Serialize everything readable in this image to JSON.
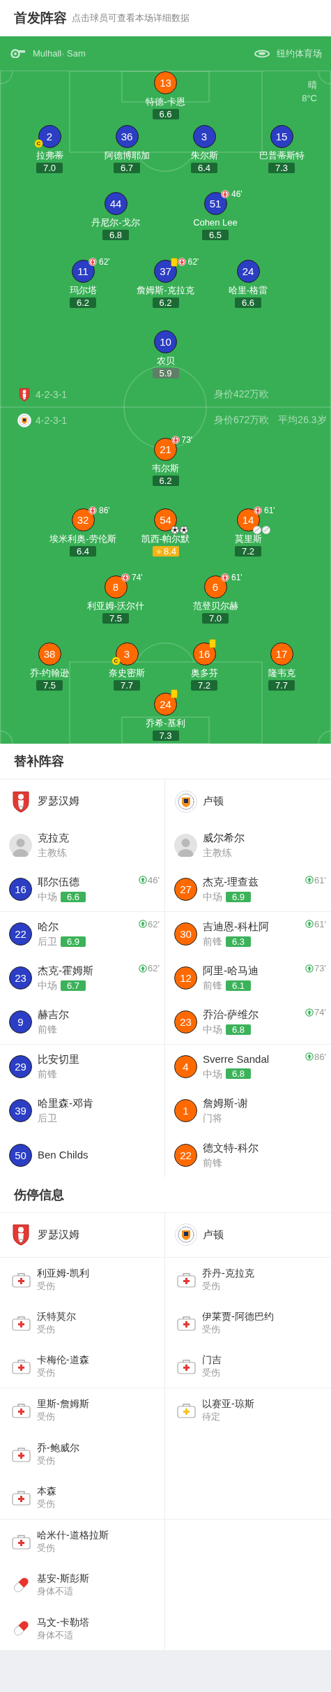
{
  "header": {
    "title": "首发阵容",
    "subtitle": "点击球员可查看本场详细数据"
  },
  "match_info": {
    "referee": "Mulhall· Sam",
    "venue": "纽约体育场",
    "weather": "晴",
    "temperature": "8°C"
  },
  "home": {
    "lines": [
      [
        {
          "number": "13",
          "name": "特德-卡恩",
          "rating": "6.6",
          "low_rating": false,
          "best_player": false,
          "color": "#ff6a00",
          "yellow_card": false
        }
      ],
      [
        {
          "number": "2",
          "name": "拉弗蒂",
          "rating": "7.0",
          "low_rating": false,
          "best_player": false,
          "color": "#2b3ec4",
          "captain_badge": "C",
          "yellow_card": false
        },
        {
          "number": "36",
          "name": "阿德博耶加",
          "rating": "6.7",
          "low_rating": false,
          "best_player": false,
          "color": "#2b3ec4",
          "yellow_card": false
        },
        {
          "number": "3",
          "name": "朱尔斯",
          "rating": "6.4",
          "low_rating": false,
          "best_player": false,
          "color": "#2b3ec4",
          "yellow_card": false
        },
        {
          "number": "15",
          "name": "巴普蒂斯特",
          "rating": "7.3",
          "low_rating": false,
          "best_player": false,
          "color": "#2b3ec4",
          "yellow_card": false
        }
      ],
      [
        {
          "number": "44",
          "name": "丹尼尔-戈尔",
          "rating": "6.8",
          "low_rating": false,
          "best_player": false,
          "color": "#2b3ec4",
          "yellow_card": false
        },
        {
          "number": "51",
          "name": "Cohen Lee",
          "rating": "6.5",
          "low_rating": false,
          "best_player": false,
          "color": "#2b3ec4",
          "yellow_card": false,
          "sub_off": "46'"
        }
      ],
      [
        {
          "number": "11",
          "name": "玛尔塔",
          "rating": "6.2",
          "low_rating": false,
          "best_player": false,
          "color": "#2b3ec4",
          "yellow_card": false,
          "sub_off": "62'"
        },
        {
          "number": "37",
          "name": "詹姆斯-克拉克",
          "rating": "6.2",
          "low_rating": false,
          "best_player": false,
          "color": "#2b3ec4",
          "yellow_card": true,
          "sub_off": "62'"
        },
        {
          "number": "24",
          "name": "哈里-格雷",
          "rating": "6.6",
          "low_rating": false,
          "best_player": false,
          "color": "#2b3ec4",
          "yellow_card": false
        }
      ],
      [
        {
          "number": "10",
          "name": "农贝",
          "rating": "5.9",
          "low_rating": true,
          "best_player": false,
          "color": "#2b3ec4",
          "yellow_card": false
        }
      ]
    ]
  },
  "formations": [
    {
      "kind": "shield",
      "formation": "4-2-3-1",
      "value": "身价422万欧"
    },
    {
      "kind": "round",
      "formation": "4-2-3-1",
      "value": "身价672万欧",
      "average_age": "平均26.3岁"
    }
  ],
  "away": {
    "lines": [
      [
        {
          "number": "21",
          "name": "韦尔斯",
          "rating": "6.2",
          "low_rating": false,
          "best_player": false,
          "color": "#ff6a00",
          "yellow_card": false,
          "sub_off": "73'"
        }
      ],
      [
        {
          "number": "32",
          "name": "埃米利奥-劳伦斯",
          "rating": "6.4",
          "low_rating": false,
          "best_player": false,
          "color": "#ff6a00",
          "yellow_card": false,
          "sub_off": "86'"
        },
        {
          "number": "54",
          "name": "凯西-帕尔默",
          "rating": "8.4",
          "low_rating": false,
          "best_player": true,
          "color": "#ff6a00",
          "yellow_card": false,
          "events": [
            {
              "kind": "goal"
            },
            {
              "kind": "goal"
            }
          ]
        },
        {
          "number": "14",
          "name": "莫里斯",
          "rating": "7.2",
          "low_rating": false,
          "best_player": false,
          "color": "#ff6a00",
          "yellow_card": false,
          "sub_off": "61'",
          "events": [
            {
              "kind": "assist"
            },
            {
              "kind": "assist"
            }
          ]
        }
      ],
      [
        {
          "number": "8",
          "name": "利亚姆-沃尔什",
          "rating": "7.5",
          "low_rating": false,
          "best_player": false,
          "color": "#ff6a00",
          "yellow_card": false,
          "sub_off": "74'"
        },
        {
          "number": "6",
          "name": "范登贝尔赫",
          "rating": "7.0",
          "low_rating": false,
          "best_player": false,
          "color": "#ff6a00",
          "yellow_card": false,
          "sub_off": "61'"
        }
      ],
      [
        {
          "number": "38",
          "name": "乔-约翰逊",
          "rating": "7.5",
          "low_rating": false,
          "best_player": false,
          "color": "#ff6a00",
          "yellow_card": false
        },
        {
          "number": "3",
          "name": "奈史密斯",
          "rating": "7.7",
          "low_rating": false,
          "best_player": false,
          "color": "#ff6a00",
          "captain_badge": "C",
          "yellow_card": false
        },
        {
          "number": "16",
          "name": "奥多芬",
          "rating": "7.2",
          "low_rating": false,
          "best_player": false,
          "color": "#ff6a00",
          "yellow_card": true
        },
        {
          "number": "17",
          "name": "隆韦克",
          "rating": "7.7",
          "low_rating": false,
          "best_player": false,
          "color": "#ff6a00",
          "yellow_card": false
        }
      ],
      [
        {
          "number": "24",
          "name": "乔希-基利",
          "rating": "7.3",
          "low_rating": false,
          "best_player": false,
          "color": "#ff6a00",
          "yellow_card": true
        }
      ]
    ]
  },
  "substitutes": {
    "title": "替补阵容",
    "teams": [
      {
        "kind": "shield",
        "name": "罗瑟汉姆",
        "coach": {
          "name": "克拉克",
          "role": "主教练"
        },
        "players": [
          {
            "number": "16",
            "name": "耶尔伍德",
            "position": "中场",
            "rating": "6.6",
            "sub_in": "46'",
            "color": "#2b3ec4"
          },
          {
            "number": "22",
            "name": "哈尔",
            "position": "后卫",
            "rating": "6.9",
            "sub_in": "62'",
            "color": "#2b3ec4"
          },
          {
            "number": "23",
            "name": "杰克-霍姆斯",
            "position": "中场",
            "rating": "6.7",
            "sub_in": "62'",
            "color": "#2b3ec4"
          },
          {
            "number": "9",
            "name": "赫吉尔",
            "position": "前锋",
            "color": "#2b3ec4"
          },
          {
            "number": "29",
            "name": "比安切里",
            "position": "前锋",
            "color": "#2b3ec4"
          },
          {
            "number": "39",
            "name": "哈里森-邓肯",
            "position": "后卫",
            "color": "#2b3ec4"
          },
          {
            "number": "50",
            "name": "Ben Childs",
            "color": "#2b3ec4"
          }
        ]
      },
      {
        "kind": "round",
        "name": "卢顿",
        "coach": {
          "name": "威尔希尔",
          "role": "主教练"
        },
        "players": [
          {
            "number": "27",
            "name": "杰克-理查兹",
            "position": "中场",
            "rating": "6.9",
            "sub_in": "61'",
            "color": "#ff6a00"
          },
          {
            "number": "30",
            "name": "吉迪恩-科杜阿",
            "position": "前锋",
            "rating": "6.3",
            "sub_in": "61'",
            "color": "#ff6a00"
          },
          {
            "number": "12",
            "name": "阿里-哈马迪",
            "position": "前锋",
            "rating": "6.1",
            "sub_in": "73'",
            "color": "#ff6a00"
          },
          {
            "number": "23",
            "name": "乔治-萨维尔",
            "position": "中场",
            "rating": "6.8",
            "sub_in": "74'",
            "color": "#ff6a00"
          },
          {
            "number": "4",
            "name": "Sverre Sandal",
            "position": "中场",
            "rating": "6.8",
            "sub_in": "86'",
            "color": "#ff6a00"
          },
          {
            "number": "1",
            "name": "詹姆斯-谢",
            "position": "门将",
            "color": "#ff6a00"
          },
          {
            "number": "22",
            "name": "德文特-科尔",
            "position": "前锋",
            "color": "#ff6a00"
          }
        ]
      }
    ]
  },
  "injuries": {
    "title": "伤停信息",
    "teams": [
      {
        "kind": "shield",
        "name": "罗瑟汉姆",
        "players": [
          {
            "name": "利亚姆-凯利",
            "status": "受伤",
            "kind": "injury"
          },
          {
            "name": "沃特莫尔",
            "status": "受伤",
            "kind": "injury"
          },
          {
            "name": "卡梅伦-道森",
            "status": "受伤",
            "kind": "injury"
          },
          {
            "name": "里斯-詹姆斯",
            "status": "受伤",
            "kind": "injury"
          },
          {
            "name": "乔-鲍威尔",
            "status": "受伤",
            "kind": "injury"
          },
          {
            "name": "本森",
            "status": "受伤",
            "kind": "injury"
          },
          {
            "name": "哈米什-道格拉斯",
            "status": "受伤",
            "kind": "injury"
          },
          {
            "name": "基安-斯彭斯",
            "status": "身体不适",
            "kind": "illness"
          },
          {
            "name": "马文-卡勒塔",
            "status": "身体不适",
            "kind": "illness"
          }
        ]
      },
      {
        "kind": "round",
        "name": "卢顿",
        "players": [
          {
            "name": "乔丹-克拉克",
            "status": "受伤",
            "kind": "injury"
          },
          {
            "name": "伊莱贾-阿德巴约",
            "status": "受伤",
            "kind": "injury"
          },
          {
            "name": "门吉",
            "status": "受伤",
            "kind": "injury"
          },
          {
            "name": "以赛亚-琼斯",
            "status": "待定",
            "kind": "pending"
          }
        ]
      }
    ]
  }
}
